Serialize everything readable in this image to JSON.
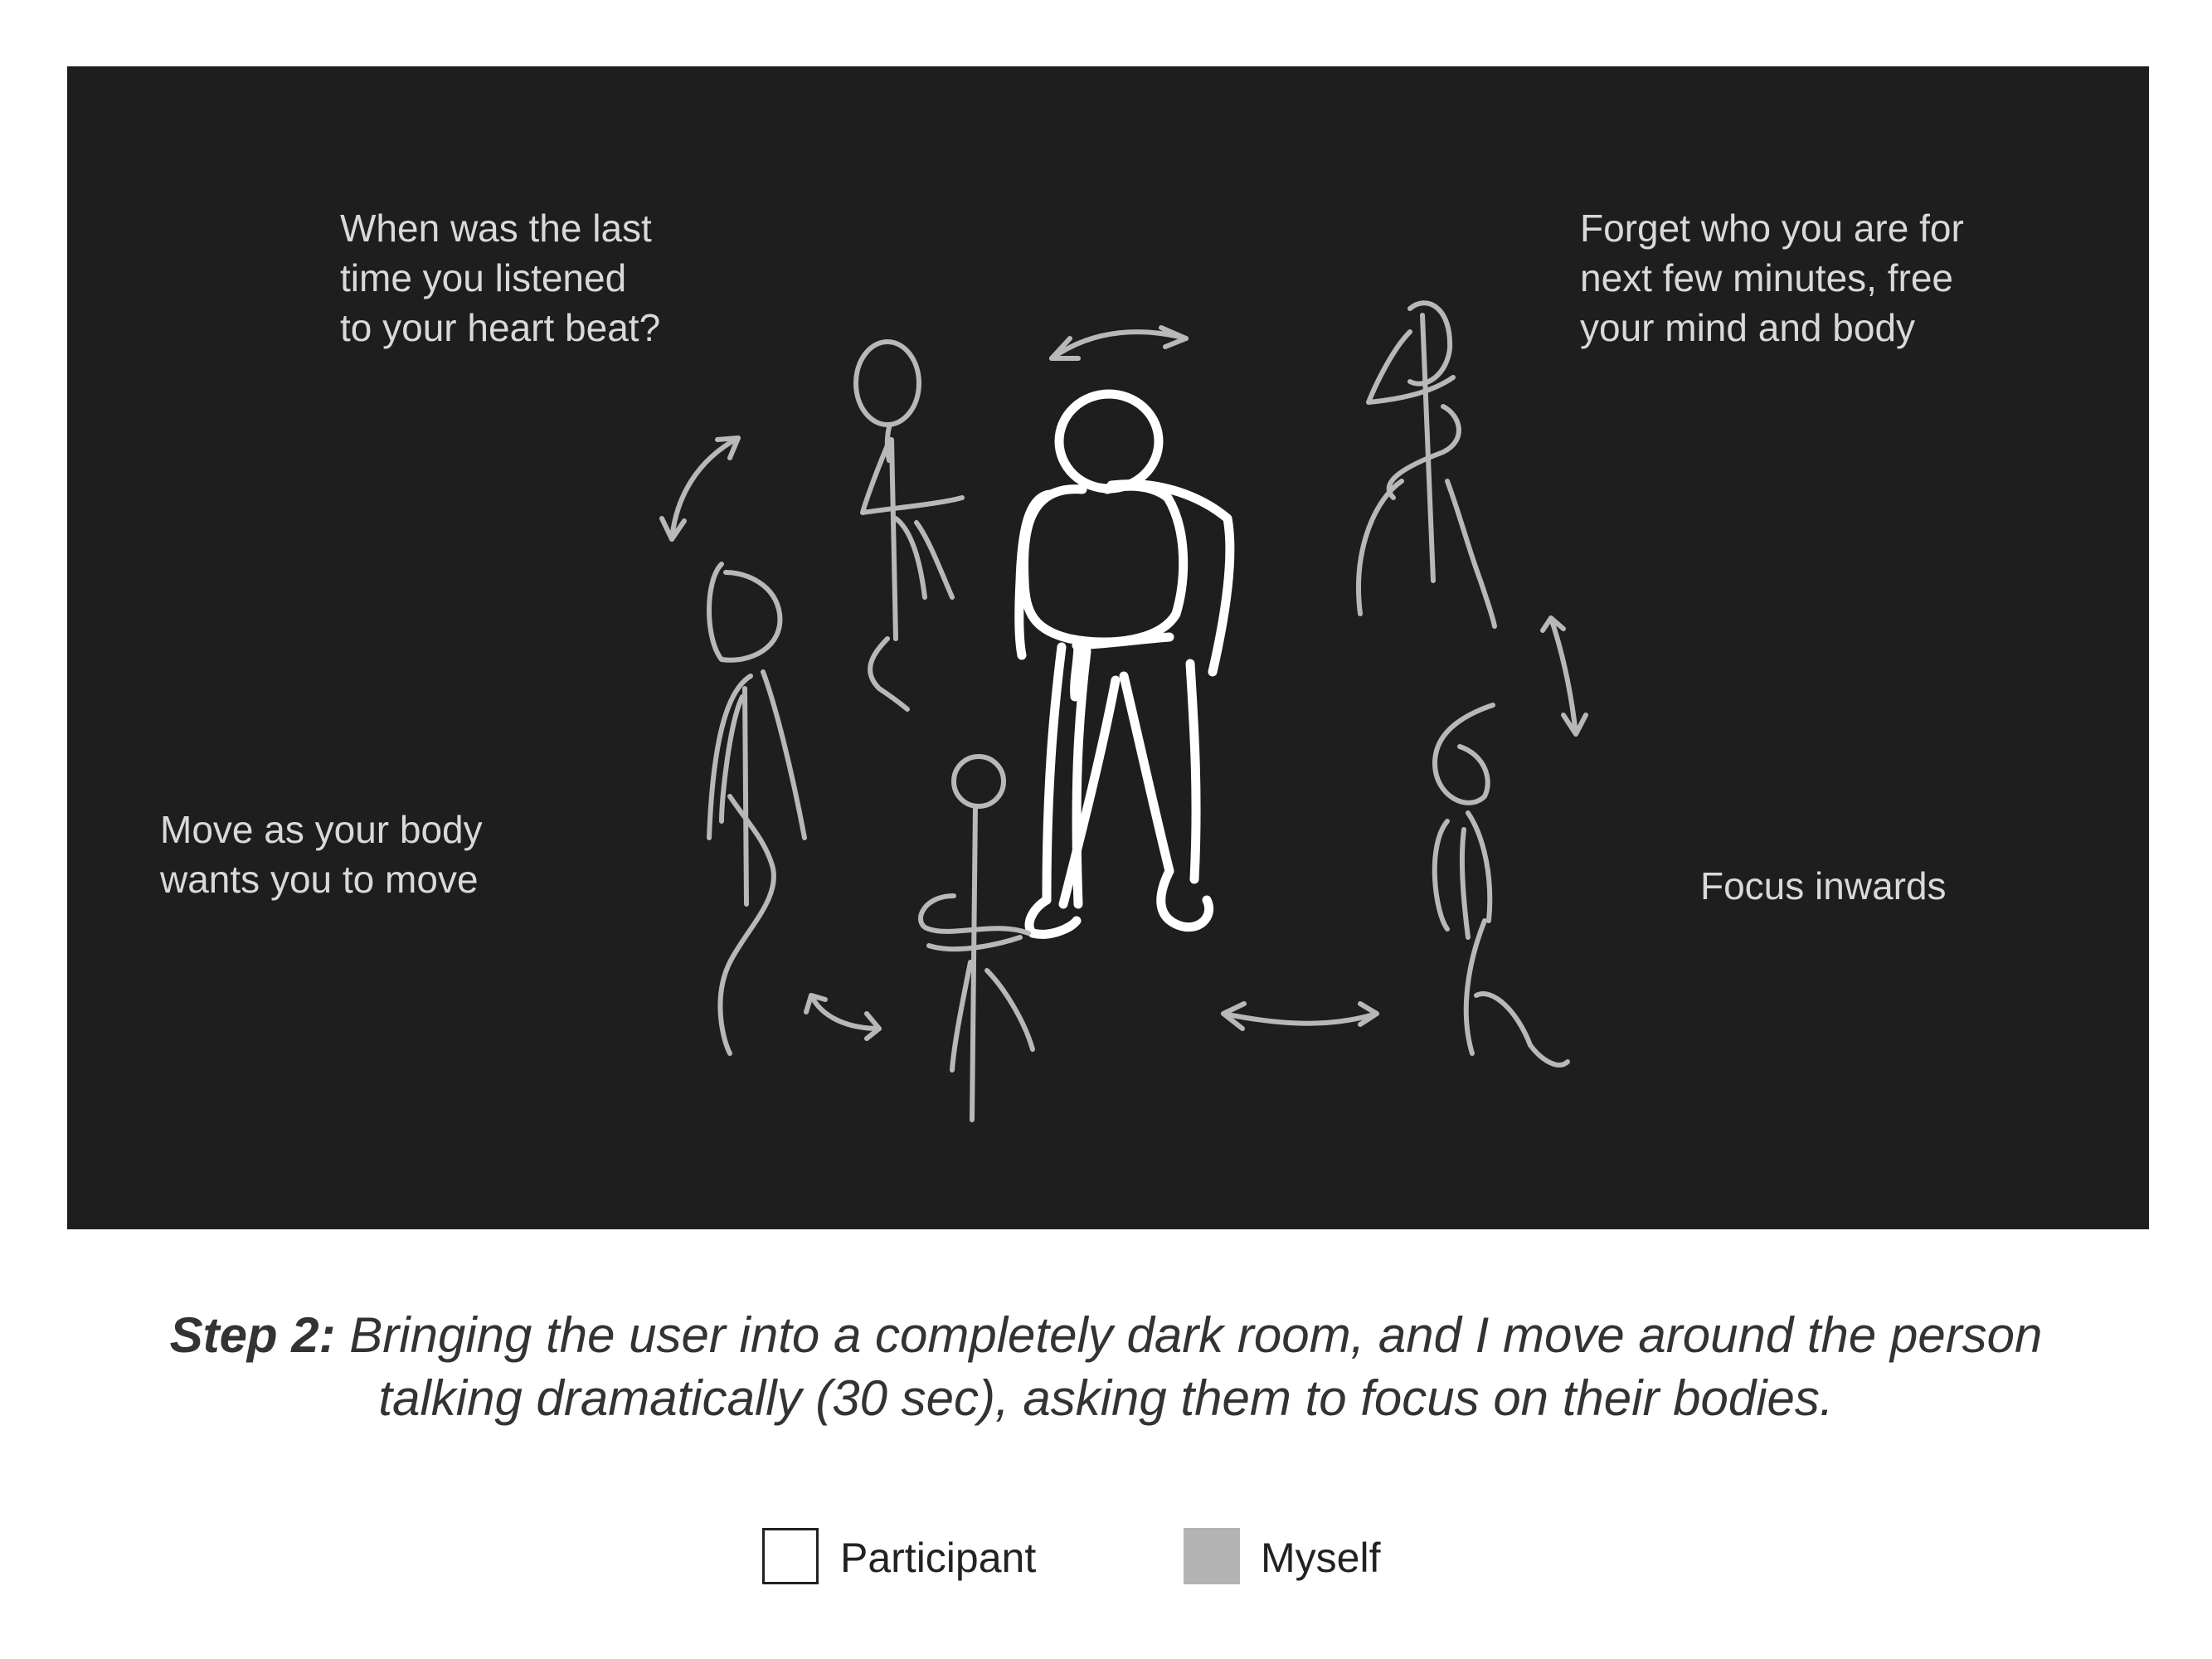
{
  "panel": {
    "background": "#1e1e1e",
    "quotes": [
      "When was the last\ntime you listened\nto your heart beat?",
      "Forget who you are for\nnext few minutes, free\nyour mind and body",
      "Move as your body\nwants you to move",
      "Focus inwards"
    ]
  },
  "caption": {
    "step_label": "Step 2:",
    "text": " Bringing the user into a completely dark room, and I move around the person talking dramatically (30 sec), asking them to focus on their bodies."
  },
  "legend": {
    "items": [
      {
        "label": "Participant",
        "color": "#ffffff"
      },
      {
        "label": "Myself",
        "color": "#b3b3b3"
      }
    ]
  },
  "colors": {
    "participant_stroke": "#ffffff",
    "myself_stroke": "#b8b8b8",
    "text_light": "#d9d9d9"
  }
}
